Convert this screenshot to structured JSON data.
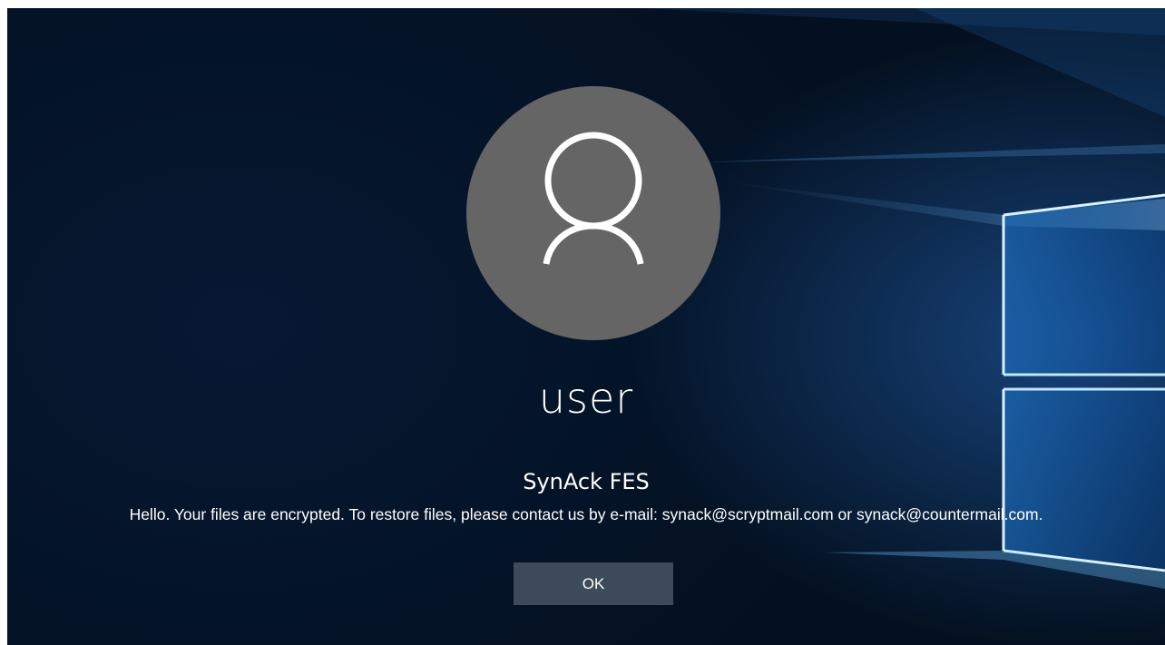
{
  "lock_screen": {
    "avatar_icon": "user-icon",
    "username": "user",
    "app_title": "SynAck FES",
    "message": "Hello. Your files are encrypted. To restore files, please contact us by e-mail: synack@scryptmail.com or synack@countermail.com.",
    "ok_label": "OK"
  },
  "colors": {
    "avatar_background": "#656565",
    "screen_background": "#061833",
    "light_beam": "#6fc3ff"
  }
}
